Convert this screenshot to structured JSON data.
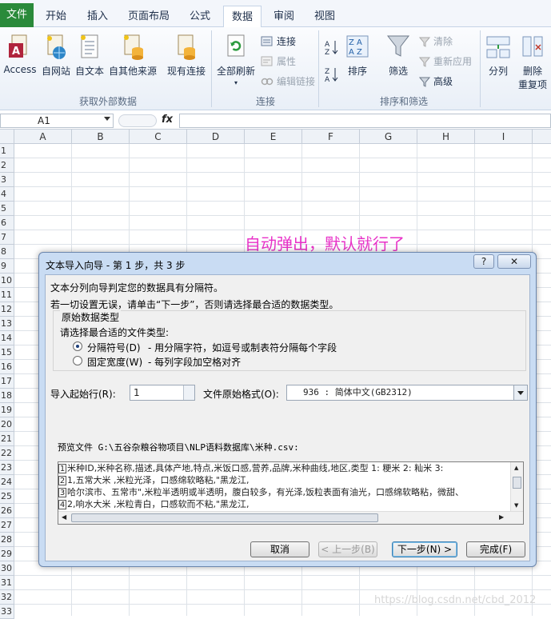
{
  "tabs": [
    "文件",
    "开始",
    "插入",
    "页面布局",
    "公式",
    "数据",
    "审阅",
    "视图"
  ],
  "ribbon": {
    "get_external": {
      "buttons": [
        "Access",
        "自网站",
        "自文本",
        "自其他来源",
        "现有连接"
      ],
      "group_label": "获取外部数据"
    },
    "connections": {
      "refresh_all": "全部刷新",
      "items": [
        "连接",
        "属性",
        "编辑链接"
      ],
      "group_label": "连接"
    },
    "sort_filter": {
      "sort": "排序",
      "filter": "筛选",
      "items": [
        "清除",
        "重新应用",
        "高级"
      ],
      "group_label": "排序和筛选"
    },
    "data_tools": {
      "split": "分列",
      "remove_dup_1": "删除",
      "remove_dup_2": "重复项"
    }
  },
  "formula_bar": {
    "name_box": "A1",
    "fx": "fx",
    "value": ""
  },
  "columns": [
    "A",
    "B",
    "C",
    "D",
    "E",
    "F",
    "G",
    "H",
    "I"
  ],
  "rows": [
    "1",
    "2",
    "3",
    "4",
    "5",
    "6",
    "7",
    "8",
    "9",
    "10",
    "11",
    "12",
    "13",
    "14",
    "15",
    "16",
    "17",
    "18",
    "19",
    "20",
    "21",
    "22",
    "23",
    "24",
    "25",
    "26",
    "27",
    "28",
    "29",
    "30",
    "31",
    "32",
    "33"
  ],
  "annotation": "自动弹出，默认就行了",
  "dialog": {
    "title": "文本导入向导 - 第 1 步，共 3 步",
    "help": "?",
    "close": "✕",
    "intro1": "文本分列向导判定您的数据具有分隔符。",
    "intro2": "若一切设置无误，请单击“下一步”，否则请选择最合适的数据类型。",
    "group_title": "原始数据类型",
    "group_prompt": "请选择最合适的文件类型:",
    "option1_label": "分隔符号(D)",
    "option1_desc": "- 用分隔字符，如逗号或制表符分隔每个字段",
    "option2_label": "固定宽度(W)",
    "option2_desc": "- 每列字段加空格对齐",
    "start_row_label": "导入起始行(R):",
    "start_row_value": "1",
    "origin_label": "文件原始格式(O):",
    "origin_value": "936 : 简体中文(GB2312)",
    "preview_label": "预览文件 G:\\五谷杂粮谷物项目\\NLP语料数据库\\米种.csv:",
    "preview_lines": [
      {
        "num": "1",
        "text": "米种ID,米种名称,描述,具体产地,特点,米饭口感,营养,品牌,米种曲线,地区,类型 1: 粳米 2: 籼米 3:"
      },
      {
        "num": "2",
        "text": "1,五常大米 ,米粒光泽，口感绵软略粘,\"黑龙江,"
      },
      {
        "num": "3",
        "text": "哈尔滨市、五常市\",米粒半透明或半透明，腹白较多，有光泽,饭粒表面有油光，口感绵软略粘，微甜、"
      },
      {
        "num": "4",
        "text": "2,响水大米 ,米粒青白，口感软而不粘,\"黑龙江,"
      }
    ],
    "buttons": {
      "cancel": "取消",
      "back": "< 上一步(B)",
      "next": "下一步(N) >",
      "finish": "完成(F)"
    }
  },
  "watermark": "https://blog.csdn.net/cbd_2012",
  "colors": {
    "file_tab": "#2a8a3a",
    "annotation": "#e832c8",
    "dialog_frame": "#c9dcf3"
  }
}
